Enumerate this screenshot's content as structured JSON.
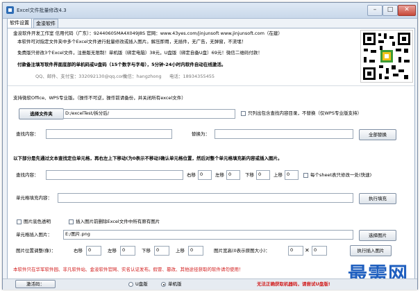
{
  "window": {
    "title": "Excel文件批量修改4.3",
    "minimize_label": "–",
    "maximize_label": "□",
    "close_label": "✕"
  },
  "tabs": [
    "软件设置",
    "金浚软件"
  ],
  "info": {
    "line1": "金浚软件开发工作室 信用代码（广东）：92440605MA4X049J8S 官网：www.43yes.com/jinjunsoft  www.jinjunsoft.com（在建）",
    "line2": "本软件可对指定文件夹中多个Excel文件进行批量修改或插入图片。解压即用，无插件，无广告，无弹窗，不流氓！",
    "line3": "免费版只修改3个Excel文件，注册版无限制！单机版（绑定电脑）38元，U盘版（绑定自备U盘）69元！微信二维码付款！",
    "line4": "付款备注填写软件界面底部的单机码或U盘码（15个数字与字母），5分钟-24小时内软件自动在线激活。",
    "contact_qq": "QQ、邮件、支付宝：332092130@qq.com",
    "contact_wechat": "微信：hangzhong",
    "contact_phone": "电话：18934355455"
  },
  "support_note": "支持微软Office、WPS专业版。（操作不可逆，操作前请备份，并关闭所有excel文件）",
  "folder": {
    "button": "选择文件夹",
    "path": "D:/excelTest/拆分后/",
    "only_current_label": "只列出包含查找内容目录，不替换（仅WPS专业版支持）"
  },
  "find_replace": {
    "find_label": "查找内容：",
    "find_value": "",
    "replace_label": "替换为：",
    "replace_value": "",
    "replace_all_button": "全部替换"
  },
  "locate_note": "以下部分是先通过文本查找定位单元格，再右左上下移动(为0表示不移动)确认单元格位置，然后对整个单元格填充新内容或插入图片。",
  "locate": {
    "find_label": "查找内容：",
    "find_value": "",
    "right_label": "右移",
    "right_value": "0",
    "left_label": "左移",
    "left_value": "0",
    "down_label": "下移",
    "down_value": "0",
    "up_label": "上移",
    "up_value": "0",
    "each_sheet_label": "每个sheet表只修改一处(快速)"
  },
  "fill": {
    "label": "单元格填充内容：",
    "value": "",
    "button": "执行填充"
  },
  "image": {
    "transparent_label": "图片底色透明",
    "delete_before_label": "插入图片前删除Excel文件中所有原有图片",
    "insert_label": "单元格插入图片：",
    "path": "E:/图片.png",
    "choose_button": "选择图片"
  },
  "position": {
    "label": "图片位置调整(像)：",
    "right_label": "右移",
    "right_value": "0",
    "left_label": "左移",
    "left_value": "0",
    "down_label": "下移",
    "down_value": "0",
    "up_label": "上移",
    "up_value": "0",
    "size_label": "图片宽高(0表示原图大小)：",
    "width_value": "0",
    "x_sep": "✕",
    "height_value": "0",
    "insert_button": "执行插入图片"
  },
  "footer_note": "本软件只在华军软件园、非凡软件站、金浚软件官网、实名认证发布。假冒、篡改、其他途径获取的软件请勿使用！",
  "status": {
    "activate_button": "激活码：",
    "usb_label": "U盘版",
    "standalone_label": "单机版",
    "warning": "无法正确获取机器码，请尝试U盘版!"
  },
  "watermark": "最需网",
  "colors": {
    "accent_red": "#d11a1a",
    "watermark_blue": "#1f5fbf",
    "window_bg": "#eef2f7"
  },
  "icons": [
    "app-icon",
    "qr-code-icon"
  ]
}
